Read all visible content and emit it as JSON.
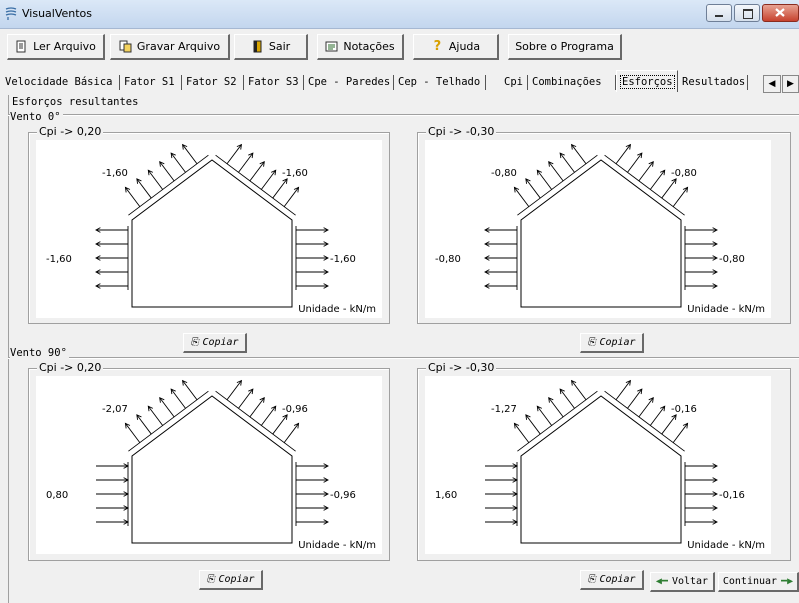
{
  "window": {
    "title": "VisualVentos"
  },
  "toolbar": [
    {
      "label": "Ler Arquivo",
      "icon": "open-file-icon"
    },
    {
      "label": "Gravar Arquivo",
      "icon": "save-file-icon"
    },
    {
      "label": "Sair",
      "icon": "exit-door-icon"
    },
    {
      "label": "Notações",
      "icon": "notes-icon"
    },
    {
      "label": "Ajuda",
      "icon": "help-icon"
    },
    {
      "label": "Sobre o Programa",
      "icon": ""
    }
  ],
  "tabs": [
    "Velocidade Básica",
    "Fator S1",
    "Fator S2",
    "Fator S3",
    "Cpe - Paredes",
    "Cep - Telhado",
    "Cpi",
    "Combinações",
    "Esforços",
    "Resultados"
  ],
  "active_tab": "Esforços",
  "main": {
    "section_title": "Esforços resultantes",
    "wind0_label": "Vento 0°",
    "wind90_label": "Vento 90°",
    "copy_label": "Copiar",
    "back_label": "Voltar",
    "continue_label": "Continuar",
    "panels": [
      {
        "title": "Cpi -> 0,20",
        "roof_left": "-1,60",
        "roof_right": "-1,60",
        "wall_left": "-1,60",
        "wall_right": "-1,60",
        "unit": "Unidade - kN/m",
        "left_dir": "out",
        "right_dir": "out"
      },
      {
        "title": "Cpi -> -0,30",
        "roof_left": "-0,80",
        "roof_right": "-0,80",
        "wall_left": "-0,80",
        "wall_right": "-0,80",
        "unit": "Unidade - kN/m",
        "left_dir": "out",
        "right_dir": "out"
      },
      {
        "title": "Cpi -> 0,20",
        "roof_left": "-2,07",
        "roof_right": "-0,96",
        "wall_left": "0,80",
        "wall_right": "-0,96",
        "unit": "Unidade - kN/m",
        "left_dir": "in",
        "right_dir": "out"
      },
      {
        "title": "Cpi -> -0,30",
        "roof_left": "-1,27",
        "roof_right": "-0,16",
        "wall_left": "1,60",
        "wall_right": "-0,16",
        "unit": "Unidade - kN/m",
        "left_dir": "in",
        "right_dir": "out"
      }
    ]
  }
}
